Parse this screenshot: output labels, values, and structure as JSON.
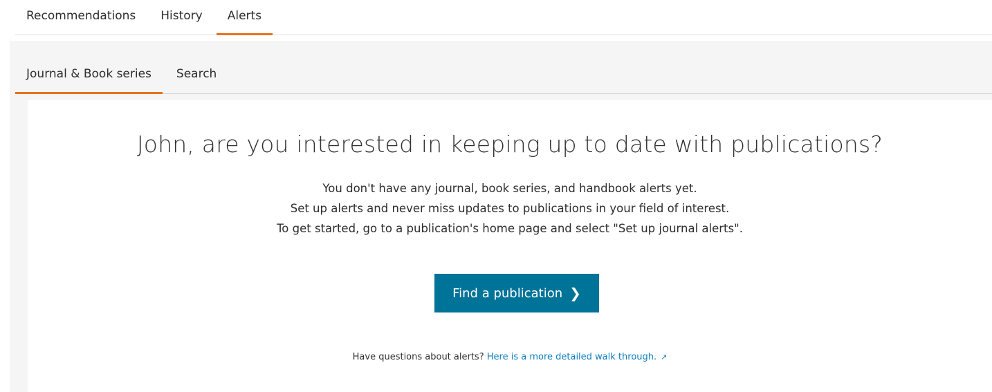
{
  "top_tabs": [
    {
      "label": "Recommendations",
      "active": false
    },
    {
      "label": "History",
      "active": false
    },
    {
      "label": "Alerts",
      "active": true
    }
  ],
  "sub_tabs": [
    {
      "label": "Journal & Book series",
      "active": true
    },
    {
      "label": "Search",
      "active": false
    }
  ],
  "empty_state": {
    "headline": "John, are you interested in keeping up to date with publications?",
    "lines": [
      "You don't have any journal, book series, and handbook alerts yet.",
      "Set up alerts and never miss updates to publications in your field of interest.",
      "To get started, go to a publication's home page and select \"Set up journal alerts\"."
    ],
    "button_label": "Find a publication",
    "button_icon": "chevron-right-icon",
    "help_text": "Have questions about alerts?",
    "help_link": "Here is a more detailed walk through.",
    "help_link_icon": "external-link-icon"
  },
  "colors": {
    "accent_orange": "#e9711c",
    "button_blue": "#007398",
    "link_blue": "#0c7dbb"
  }
}
